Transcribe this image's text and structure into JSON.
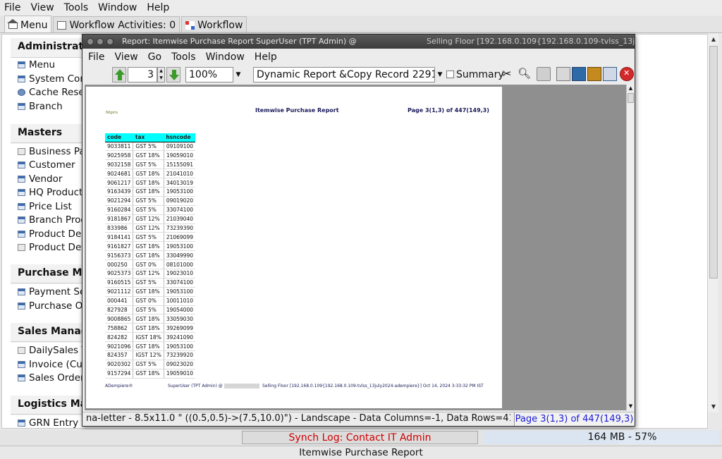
{
  "main_menu": [
    "File",
    "View",
    "Tools",
    "Window",
    "Help"
  ],
  "main_tabs": {
    "menu": "Menu",
    "workflow_activities": "Workflow Activities: 0",
    "workflow": "Workflow"
  },
  "sections": [
    {
      "title": "Administration",
      "items": [
        "Menu",
        "System Conf",
        "Cache Reset",
        "Branch"
      ]
    },
    {
      "title": "Masters",
      "items": [
        "Business Par",
        "Customer",
        "Vendor",
        "HQ Product N",
        "Price List",
        "Branch Produ",
        "Product Depa",
        "Product Deta"
      ]
    },
    {
      "title": "Purchase Man",
      "items": [
        "Payment Sel",
        "Purchase Ord"
      ]
    },
    {
      "title": "Sales Manage",
      "items": [
        "DailySales Te",
        "Invoice (Cus",
        "Sales Order"
      ]
    },
    {
      "title": "Logistics Man",
      "items": [
        "GRN Entry"
      ]
    }
  ],
  "status": {
    "synch_log": "Synch Log: Contact IT Admin",
    "memory": "164 MB - 57%",
    "memory_fraction": 0.57,
    "footer_title": "Itemwise Purchase Report"
  },
  "report_window": {
    "title": "Report: Itemwise Purchase Report  SuperUser (TPT Admin) @",
    "title_right": "Selling Floor [192.168.0.109{192.168.0.109-tvlss_13jı",
    "menu": [
      "File",
      "View",
      "Go",
      "Tools",
      "Window",
      "Help"
    ],
    "toolbar": {
      "page_number": "3",
      "zoom": "100%",
      "report_selector": "Dynamic Report &Copy Record 2291032",
      "summary_label": "Summary"
    },
    "status_info": "na-letter - 8.5x11.0 \" ((0.5,0.5)->(7.5,10.0)\") - Landscape - Data Columns=-1, Data Rows=4123",
    "status_page": "Page 3(1,3) of 447(149,3)"
  },
  "report": {
    "logo_text": "Nilgiris",
    "title": "Itemwise Purchase Report",
    "page": "Page 3(1,3) of 447(149,3)",
    "columns": [
      "code",
      "tax",
      "hsncode"
    ],
    "rows": [
      [
        "9033811",
        "GST 5%",
        "09109100"
      ],
      [
        "9025958",
        "GST 18%",
        "19059010"
      ],
      [
        "9032158",
        "GST 5%",
        "15155091"
      ],
      [
        "9024681",
        "GST 18%",
        "21041010"
      ],
      [
        "9061217",
        "GST 18%",
        "34013019"
      ],
      [
        "9163439",
        "GST 18%",
        "19053100"
      ],
      [
        "9021294",
        "GST 5%",
        "09019020"
      ],
      [
        "9160284",
        "GST 5%",
        "33074100"
      ],
      [
        "9181867",
        "GST 12%",
        "21039040"
      ],
      [
        "833986",
        "GST 12%",
        "73239390"
      ],
      [
        "9184141",
        "GST 5%",
        "21069099"
      ],
      [
        "9161827",
        "GST 18%",
        "19053100"
      ],
      [
        "9156373",
        "GST 18%",
        "33049990"
      ],
      [
        "000250",
        "GST 0%",
        "08101000"
      ],
      [
        "9025373",
        "GST 12%",
        "19023010"
      ],
      [
        "9160515",
        "GST 5%",
        "33074100"
      ],
      [
        "9021112",
        "GST 18%",
        "19053100"
      ],
      [
        "000441",
        "GST 0%",
        "10011010"
      ],
      [
        "827928",
        "GST 5%",
        "19054000"
      ],
      [
        "9008865",
        "GST 18%",
        "33059030"
      ],
      [
        "758862",
        "GST 18%",
        "39269099"
      ],
      [
        "824282",
        "IGST 18%",
        "39241090"
      ],
      [
        "9021096",
        "GST 18%",
        "19053100"
      ],
      [
        "824357",
        "IGST 12%",
        "73239920"
      ],
      [
        "9020302",
        "GST 5%",
        "09023020"
      ],
      [
        "9157294",
        "GST 18%",
        "19059010"
      ]
    ],
    "footer_left": "ADempiere®",
    "footer_user": "SuperUser (TPT Admin) @",
    "footer_right": "Selling Floor [192.168.0.109{192.168.0.109-tvlss_13july2024-adempiere}] Oct 14, 2024 3:33:32 PM IST"
  }
}
